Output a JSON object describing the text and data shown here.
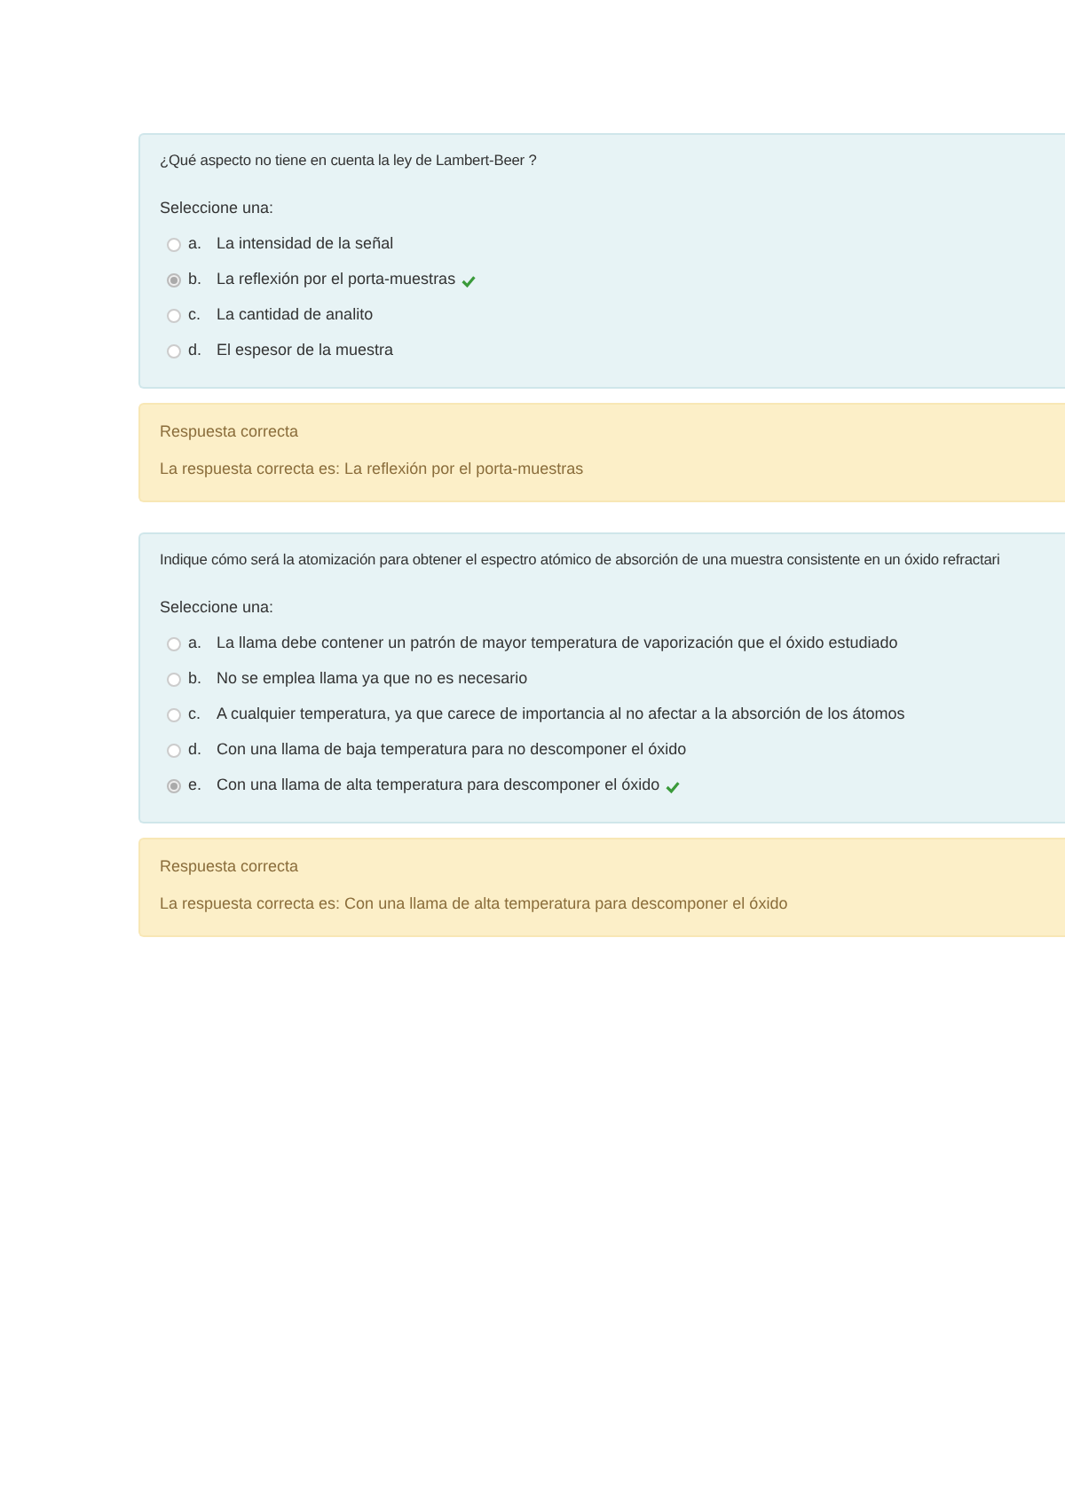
{
  "questions": [
    {
      "text": "¿Qué aspecto no tiene en cuenta la ley de Lambert-Beer ?",
      "prompt": "Seleccione una:",
      "options": [
        {
          "letter": "a.",
          "text": "La intensidad de la señal",
          "selected": false,
          "correct": false
        },
        {
          "letter": "b.",
          "text": "La reflexión por el porta-muestras",
          "selected": true,
          "correct": true
        },
        {
          "letter": "c.",
          "text": "La cantidad de analito",
          "selected": false,
          "correct": false
        },
        {
          "letter": "d.",
          "text": "El espesor de la muestra",
          "selected": false,
          "correct": false
        }
      ],
      "feedback": {
        "title": "Respuesta correcta",
        "text": "La respuesta correcta es: La reflexión por el porta-muestras"
      }
    },
    {
      "text": "Indique cómo será la atomización para obtener el espectro atómico de absorción de una muestra consistente en un óxido refractari",
      "prompt": "Seleccione una:",
      "options": [
        {
          "letter": "a.",
          "text": "La llama debe contener un patrón de mayor temperatura de vaporización que el óxido estudiado",
          "selected": false,
          "correct": false
        },
        {
          "letter": "b.",
          "text": "No se emplea llama ya que no es necesario",
          "selected": false,
          "correct": false
        },
        {
          "letter": "c.",
          "text": "A cualquier temperatura, ya que carece de importancia al no afectar a la absorción de los átomos",
          "selected": false,
          "correct": false
        },
        {
          "letter": "d.",
          "text": "Con una llama de baja temperatura para no descomponer el óxido",
          "selected": false,
          "correct": false
        },
        {
          "letter": "e.",
          "text": "Con una llama de alta temperatura para descomponer el óxido",
          "selected": true,
          "correct": true
        }
      ],
      "feedback": {
        "title": "Respuesta correcta",
        "text": "La respuesta correcta es: Con una llama de alta temperatura para descomponer el óxido"
      }
    }
  ]
}
